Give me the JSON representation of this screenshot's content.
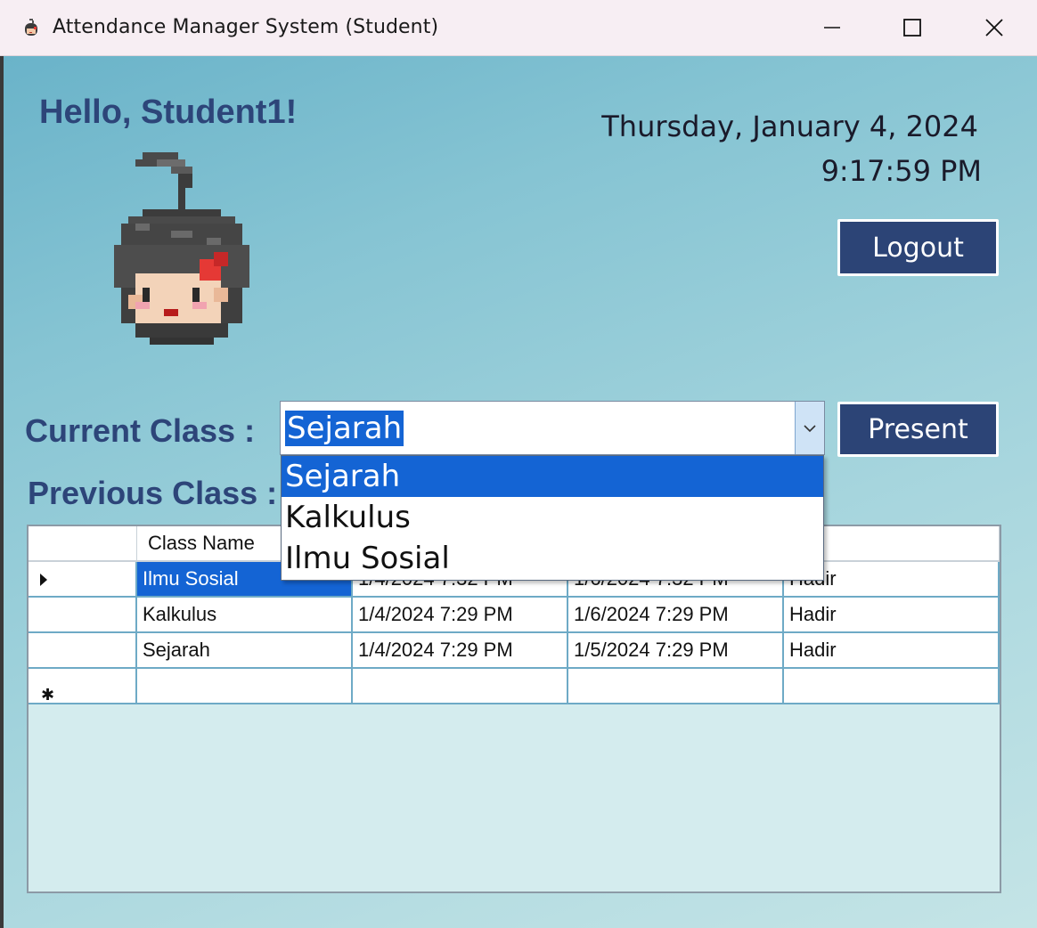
{
  "window": {
    "title": "Attendance Manager System (Student)",
    "minimize_label": "Minimize",
    "maximize_label": "Maximize",
    "close_label": "Close"
  },
  "header": {
    "greeting": "Hello, Student1!",
    "date": "Thursday, January 4, 2024",
    "time": "9:17:59 PM",
    "logout_label": "Logout"
  },
  "current_class": {
    "label": "Current Class :",
    "selected": "Sejarah",
    "options": [
      "Sejarah",
      "Kalkulus",
      "Ilmu Sosial"
    ],
    "present_label": "Present"
  },
  "previous_class": {
    "label": "Previous Class :",
    "columns": [
      "Class Name",
      "",
      "",
      "Status"
    ],
    "visible_header_fragment": "tus",
    "rows": [
      [
        "Ilmu Sosial",
        "1/4/2024 7:32 PM",
        "1/6/2024 7:32 PM",
        "Hadir"
      ],
      [
        "Kalkulus",
        "1/4/2024 7:29 PM",
        "1/6/2024 7:29 PM",
        "Hadir"
      ],
      [
        "Sejarah",
        "1/4/2024 7:29 PM",
        "1/5/2024 7:29 PM",
        "Hadir"
      ]
    ]
  },
  "colors": {
    "accent": "#2c4476",
    "selection": "#1464d4",
    "label_text": "#2d4579"
  },
  "icons": {
    "app": "pixel-girl-icon",
    "avatar": "pixel-girl-avatar"
  }
}
